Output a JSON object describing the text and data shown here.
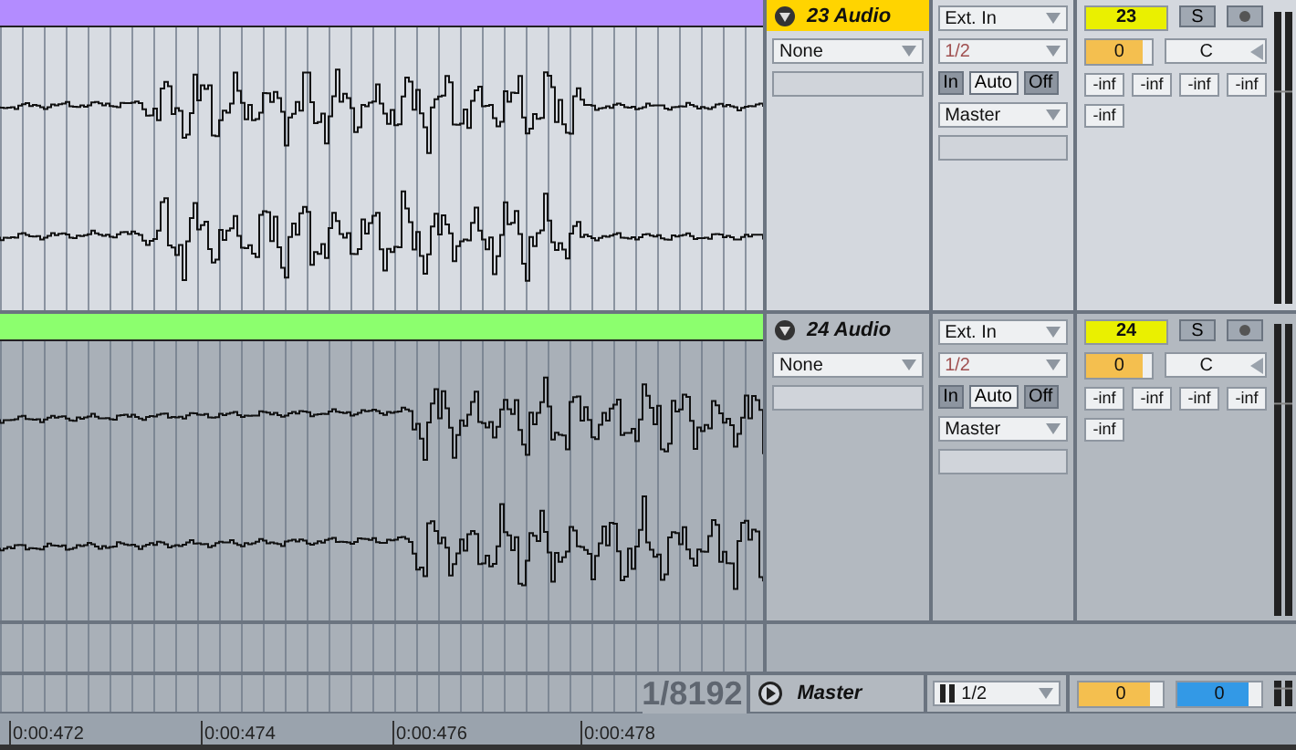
{
  "tracks": [
    {
      "name": "23 Audio",
      "selected": true,
      "color": "#b38cff",
      "device": "None",
      "input_type": "Ext. In",
      "input_channel": "1/2",
      "monitor": [
        {
          "label": "In",
          "selected": true
        },
        {
          "label": "Auto",
          "selected": false
        },
        {
          "label": "Off",
          "selected": true
        }
      ],
      "output": "Master",
      "number": "23",
      "solo": "S",
      "volume": {
        "reading": "0",
        "level": 0.85
      },
      "pan": "C",
      "readouts": [
        "-inf",
        "-inf",
        "-inf",
        "-inf"
      ],
      "peak": "-inf"
    },
    {
      "name": "24 Audio",
      "selected": false,
      "color": "#8cff6e",
      "device": "None",
      "input_type": "Ext. In",
      "input_channel": "1/2",
      "monitor": [
        {
          "label": "In",
          "selected": true
        },
        {
          "label": "Auto",
          "selected": false
        },
        {
          "label": "Off",
          "selected": true
        }
      ],
      "output": "Master",
      "number": "24",
      "solo": "S",
      "volume": {
        "reading": "0",
        "level": 0.85
      },
      "pan": "C",
      "readouts": [
        "-inf",
        "-inf",
        "-inf",
        "-inf"
      ],
      "peak": "-inf"
    }
  ],
  "master": {
    "position": "1/8192",
    "name": "Master",
    "channel": "1/2",
    "volume": {
      "reading": "0",
      "level": 0.85
    },
    "cue": {
      "reading": "0",
      "level": 0.85
    }
  },
  "ruler": [
    "0:00:472",
    "0:00:474",
    "0:00:476",
    "0:00:478"
  ]
}
